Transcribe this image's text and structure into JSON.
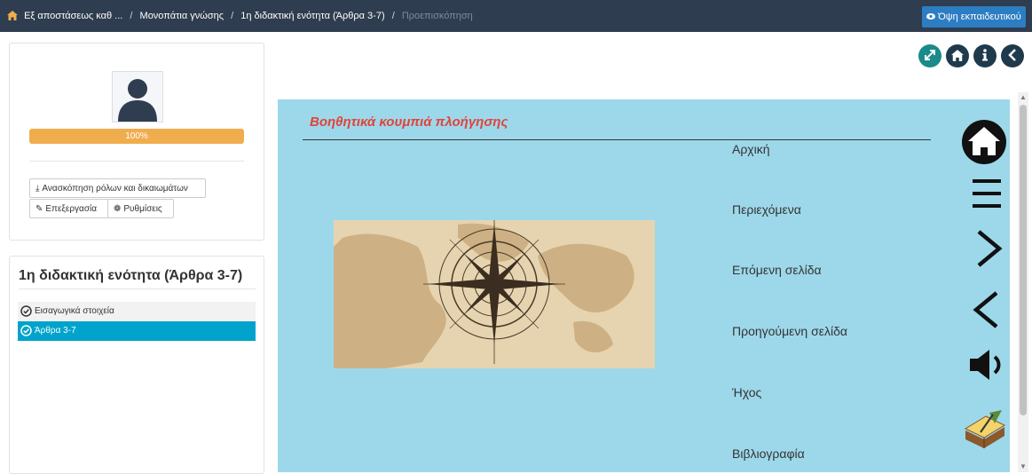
{
  "breadcrumb": {
    "items": [
      "Εξ αποστάσεως καθ ...",
      "Μονοπάτια γνώσης",
      "1η διδακτική ενότητα (Άρθρα 3-7)"
    ],
    "current": "Προεπισκόπηση"
  },
  "header": {
    "teacher_view_label": "Όψη εκπαιδευτικού"
  },
  "profile": {
    "progress_label": "100%",
    "progress_value": 1.0,
    "roles_button": "Ανασκόπηση ρόλων και δικαιωμάτων",
    "edit_button": "Επεξεργασία",
    "settings_button": "Ρυθμίσεις"
  },
  "unit": {
    "title": "1η διδακτική ενότητα (Άρθρα 3-7)",
    "items": [
      "Εισαγωγικά στοιχεία",
      "Άρθρα 3-7"
    ],
    "active_index": 1
  },
  "content": {
    "title": "Βοηθητικά κουμπιά πλοήγησης",
    "labels": [
      "Αρχική",
      "Περιεχόμενα",
      "Επόμενη σελίδα",
      "Προηγούμενη σελίδα",
      "Ήχος",
      "Βιβλιογραφία"
    ]
  },
  "colors": {
    "topbar": "#2e3d4f",
    "accent_blue": "#2d7dc2",
    "active_item": "#00a3cc",
    "tool_green": "#1a8a8a",
    "tool_navy": "#1f3a4d",
    "progress": "#f0ad4e",
    "content_bg": "#9dd8ea",
    "title_red": "#e1433a"
  },
  "icons": [
    "home-icon",
    "eye-icon",
    "user-icon",
    "download-icon",
    "pencil-icon",
    "gear-icon",
    "check-circle-icon",
    "expand-icon",
    "info-icon",
    "chevron-left-icon",
    "menu-icon",
    "chevron-right-icon",
    "volume-icon",
    "book-icon",
    "compass-icon"
  ]
}
